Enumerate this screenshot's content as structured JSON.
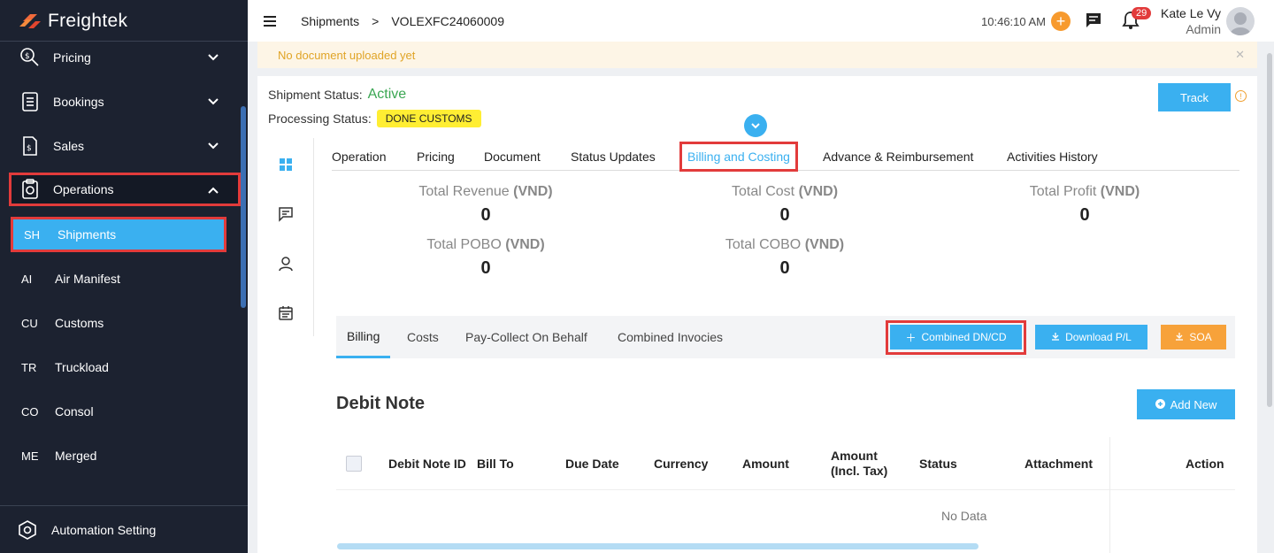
{
  "app": {
    "brand": "Freightek"
  },
  "sidebar": {
    "items": [
      {
        "label": "Pricing",
        "icon": "pricing-icon"
      },
      {
        "label": "Bookings",
        "icon": "bookings-icon"
      },
      {
        "label": "Sales",
        "icon": "sales-icon"
      },
      {
        "label": "Operations",
        "icon": "operations-icon"
      }
    ],
    "subitems": [
      {
        "abbr": "SH",
        "label": "Shipments"
      },
      {
        "abbr": "AI",
        "label": "Air Manifest"
      },
      {
        "abbr": "CU",
        "label": "Customs"
      },
      {
        "abbr": "TR",
        "label": "Truckload"
      },
      {
        "abbr": "CO",
        "label": "Consol"
      },
      {
        "abbr": "ME",
        "label": "Merged"
      }
    ],
    "bottom": {
      "label": "Automation Setting"
    }
  },
  "topbar": {
    "breadcrumb": [
      "Shipments",
      ">",
      "VOLEXFC24060009"
    ],
    "time": "10:46:10 AM",
    "notif_count": "29",
    "user_name": "Kate Le Vy",
    "user_role": "Admin"
  },
  "notice": {
    "text": "No document uploaded yet",
    "close": "✕"
  },
  "shipment": {
    "status_label": "Shipment Status:",
    "status_value": "Active",
    "processing_label": "Processing Status:",
    "processing_value": "DONE CUSTOMS",
    "track_label": "Track",
    "info": "!"
  },
  "tabs": [
    "Operation",
    "Pricing",
    "Document",
    "Status Updates",
    "Billing and Costing",
    "Advance & Reimbursement",
    "Activities History"
  ],
  "metrics": [
    {
      "label": "Total Revenue ",
      "unit": "(VND)",
      "value": "0"
    },
    {
      "label": "Total Cost ",
      "unit": "(VND)",
      "value": "0"
    },
    {
      "label": "Total Profit ",
      "unit": "(VND)",
      "value": "0"
    },
    {
      "label": "Total POBO ",
      "unit": "(VND)",
      "value": "0"
    },
    {
      "label": "Total COBO ",
      "unit": "(VND)",
      "value": "0"
    }
  ],
  "subtabs": [
    "Billing",
    "Costs",
    "Pay-Collect On Behalf",
    "Combined Invocies"
  ],
  "actions": {
    "combined": "Combined DN/CD",
    "download": "Download P/L",
    "soa": "SOA",
    "add_new": "Add New"
  },
  "debit_note": {
    "title": "Debit Note",
    "columns": [
      "Debit Note ID",
      "Bill To",
      "Due Date",
      "Currency",
      "Amount",
      "Amount (Incl. Tax)",
      "Status",
      "Attachment",
      "Action"
    ],
    "empty": "No Data"
  },
  "colors": {
    "accent": "#3ab0f0",
    "highlight": "#e23b3b",
    "success": "#3aa652",
    "warning": "#f7a23a"
  }
}
